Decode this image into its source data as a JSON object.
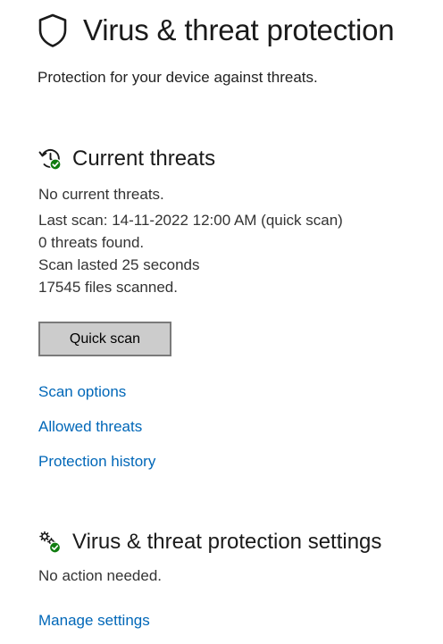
{
  "header": {
    "title": "Virus & threat protection",
    "subtitle": "Protection for your device against threats."
  },
  "current_threats": {
    "heading": "Current threats",
    "icon": "history-check-icon",
    "status": "No current threats.",
    "last_scan": "Last scan: 14-11-2022 12:00 AM (quick scan)",
    "threats_found": "0 threats found.",
    "scan_duration": "Scan lasted 25 seconds",
    "files_scanned": "17545 files scanned.",
    "quick_scan_label": "Quick scan",
    "links": {
      "scan_options": "Scan options",
      "allowed_threats": "Allowed threats",
      "protection_history": "Protection history"
    }
  },
  "settings": {
    "heading": "Virus & threat protection settings",
    "icon": "gears-check-icon",
    "status": "No action needed.",
    "manage_label": "Manage settings"
  },
  "colors": {
    "link": "#0067b8",
    "status_ok": "#107c10",
    "button_bg": "#cccccc",
    "button_border": "#7a7a7a"
  }
}
